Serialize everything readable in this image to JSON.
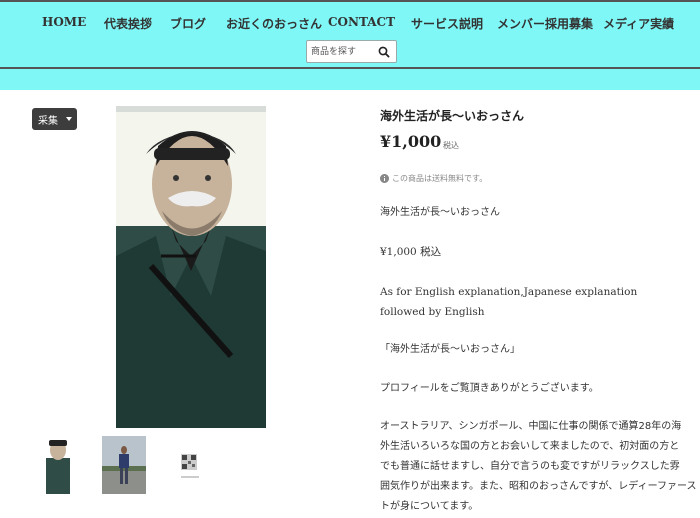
{
  "nav": {
    "items": [
      "HOME",
      "代表挨拶",
      "ブログ",
      "お近くのおっさん",
      "CONTACT",
      "サービス説明",
      "メンバー採用募集",
      "メディア実績"
    ]
  },
  "search": {
    "placeholder": "商品を探す",
    "icon": "search-icon"
  },
  "collect_button": {
    "label": "采集"
  },
  "product": {
    "title": "海外生活が長〜いおっさん",
    "price": "¥1,000",
    "tax_label": "税込",
    "shipping_note": "この商品は送料無料です。",
    "description": [
      "海外生活が長〜いおっさん",
      "¥1,000 税込",
      "As for English explanation,Japanese explanation",
      "followed by English",
      "「海外生活が長〜いおっさん」",
      "プロフィールをご覧頂きありがとうございます。",
      "オーストラリア、シンガポール、中国に仕事の関係で通算28年の海",
      "外生活いろいろな国の方とお会いして来ましたので、初対面の方と",
      "でも普通に話せますし、自分で言うのも変ですがリラックスした雰",
      "囲気作りが出来ます。また、昭和のおっさんですが、レディーファース",
      "トが身についてます。"
    ]
  },
  "colors": {
    "header_bg": "#7ff7f7",
    "content_bg": "#ffffff",
    "button_bg": "#3d3d3d"
  }
}
